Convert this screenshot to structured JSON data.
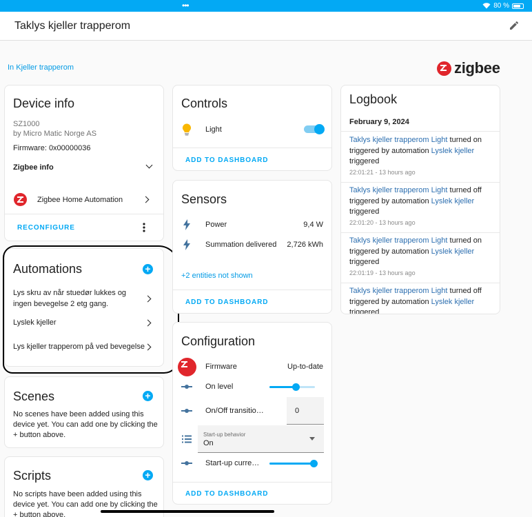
{
  "status_bar": {
    "dots": "•••",
    "battery": "80 %",
    "battery_level": 0.8
  },
  "header": {
    "title": "Taklys kjeller trapperom"
  },
  "area_link": "In Kjeller trapperom",
  "brand": {
    "name": "zigbee",
    "color": "#e0262c"
  },
  "device_info": {
    "title": "Device info",
    "model": "SZ1000",
    "manufacturer": "by Micro Matic Norge AS",
    "firmware": "Firmware: 0x00000036",
    "zigbee_info": "Zigbee info",
    "integration": "Zigbee Home Automation",
    "reconfigure": "RECONFIGURE"
  },
  "automations": {
    "title": "Automations",
    "items": [
      {
        "label": "Lys skru av når stuedør lukkes og ingen bevegelse 2 etg gang."
      },
      {
        "label": "Lyslek kjeller"
      },
      {
        "label": "Lys kjeller trapperom på ved bevegelse"
      }
    ]
  },
  "scenes": {
    "title": "Scenes",
    "empty": "No scenes have been added using this device yet. You can add one by clicking the + button above."
  },
  "scripts": {
    "title": "Scripts",
    "empty": "No scripts have been added using this device yet. You can add one by clicking the + button above."
  },
  "controls": {
    "title": "Controls",
    "light_label": "Light",
    "light_on": true,
    "add_to_dashboard": "ADD TO DASHBOARD"
  },
  "sensors": {
    "title": "Sensors",
    "items": [
      {
        "label": "Power",
        "value": "9,4 W"
      },
      {
        "label": "Summation delivered",
        "value": "2,726 kWh"
      }
    ],
    "hidden": "+2 entities not shown",
    "add_to_dashboard": "ADD TO DASHBOARD"
  },
  "configuration": {
    "title": "Configuration",
    "firmware_label": "Firmware",
    "firmware_value": "Up-to-date",
    "on_level_label": "On level",
    "on_level_fraction": 0.58,
    "transition_label": "On/Off transitio…",
    "transition_value": "0",
    "startup_behavior_label": "Start-up behavior",
    "startup_behavior_value": "On",
    "startup_current_label": "Start-up curre…",
    "startup_current_fraction": 0.97,
    "add_to_dashboard": "ADD TO DASHBOARD"
  },
  "logbook": {
    "title": "Logbook",
    "date": "February 9, 2024",
    "entries": [
      {
        "entity": "Taklys kjeller trapperom Light",
        "action": "turned on",
        "by": "triggered by automation",
        "automation": "Lyslek kjeller",
        "trigger": "triggered",
        "time": "22:01:21 - 13 hours ago"
      },
      {
        "entity": "Taklys kjeller trapperom Light",
        "action": "turned off",
        "by": "triggered by automation",
        "automation": "Lyslek kjeller",
        "trigger": "triggered",
        "time": "22:01:20 - 13 hours ago"
      },
      {
        "entity": "Taklys kjeller trapperom Light",
        "action": "turned on",
        "by": "triggered by automation",
        "automation": "Lyslek kjeller",
        "trigger": "triggered",
        "time": "22:01:19 - 13 hours ago"
      },
      {
        "entity": "Taklys kjeller trapperom Light",
        "action": "turned off",
        "by": "triggered by automation",
        "automation": "Lyslek kjeller",
        "trigger": "triggered",
        "time": ""
      }
    ]
  },
  "colors": {
    "accent": "#03a9f4",
    "bulb": "#f9b701",
    "zigbee_red": "#e0262c"
  }
}
